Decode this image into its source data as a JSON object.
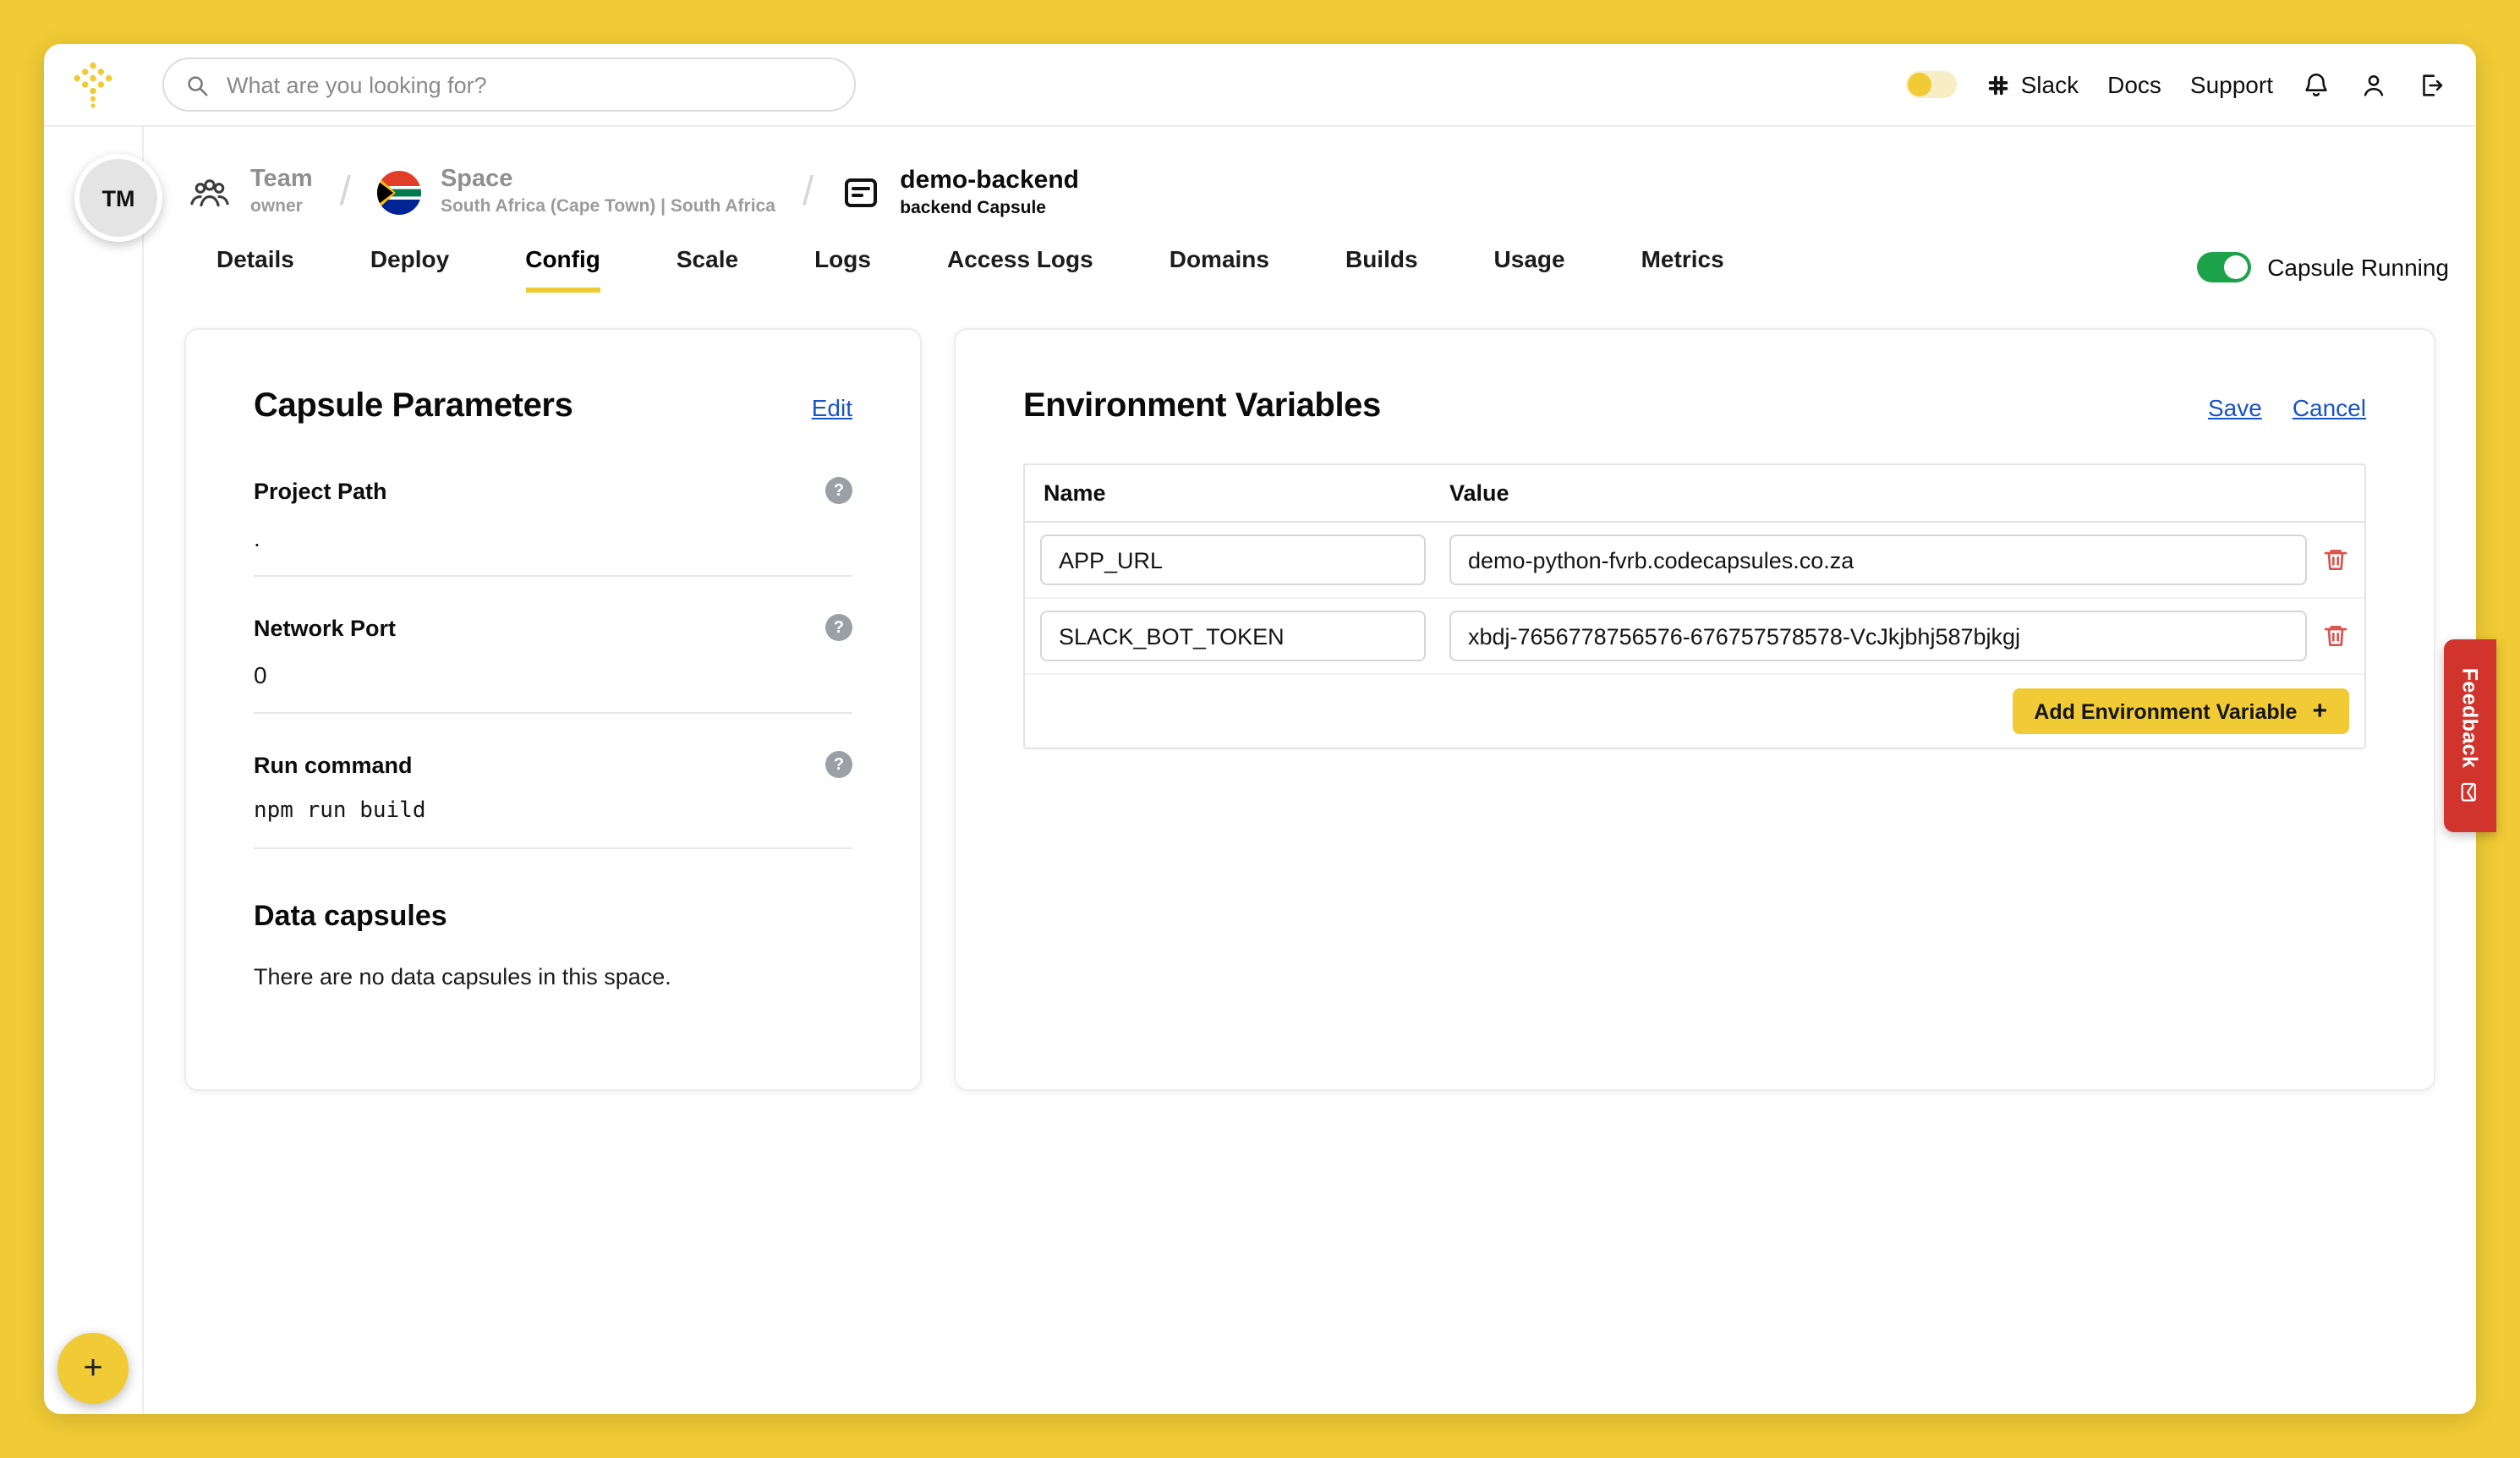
{
  "topbar": {
    "search_placeholder": "What are you looking for?",
    "nav": {
      "slack": "Slack",
      "docs": "Docs",
      "support": "Support"
    }
  },
  "breadcrumb": {
    "separator": "/",
    "team": {
      "label": "Team",
      "sub": "owner"
    },
    "space": {
      "label": "Space",
      "sub": "South Africa (Cape Town) | South Africa"
    },
    "capsule": {
      "label": "demo-backend",
      "sub": "backend Capsule"
    }
  },
  "tabs": {
    "items": [
      "Details",
      "Deploy",
      "Config",
      "Scale",
      "Logs",
      "Access Logs",
      "Domains",
      "Builds",
      "Usage",
      "Metrics"
    ],
    "active": "Config"
  },
  "status": {
    "label": "Capsule Running",
    "on": true
  },
  "params": {
    "title": "Capsule Parameters",
    "edit": "Edit",
    "help_glyph": "?",
    "fields": [
      {
        "label": "Project Path",
        "value": "."
      },
      {
        "label": "Network Port",
        "value": "0"
      },
      {
        "label": "Run command",
        "value": "npm run build"
      }
    ],
    "data_capsules": {
      "title": "Data capsules",
      "empty": "There are no data capsules in this space."
    }
  },
  "env": {
    "title": "Environment Variables",
    "save": "Save",
    "cancel": "Cancel",
    "columns": {
      "name": "Name",
      "value": "Value"
    },
    "rows": [
      {
        "name": "APP_URL",
        "value": "demo-python-fvrb.codecapsules.co.za"
      },
      {
        "name": "SLACK_BOT_TOKEN",
        "value": "xbdj-7656778756576-676757578578-VcJkjbhj587bjkgj"
      }
    ],
    "add_button": "Add Environment Variable",
    "add_plus": "+"
  },
  "sidebar": {
    "avatar": "TM",
    "add": "+"
  },
  "feedback": {
    "label": "Feedback"
  },
  "colors": {
    "brand_yellow": "#F0CB35",
    "toggle_green": "#1CA24A",
    "link_blue": "#1953C8",
    "danger_red": "#D9534F",
    "feedback_red": "#D0342C"
  },
  "icons": {
    "logo-icon": "dot-tree",
    "search-icon": "magnifier",
    "slack-icon": "slack-hash",
    "bell-icon": "bell",
    "user-icon": "person",
    "logout-icon": "arrow-exit",
    "team-icon": "people",
    "space-icon": "south-africa-flag",
    "capsule-icon": "server-list",
    "help-icon": "question-mark",
    "trash-icon": "trash",
    "mail-icon": "envelope",
    "add-icon": "plus",
    "theme-icon": "yellow-dot-toggle"
  }
}
